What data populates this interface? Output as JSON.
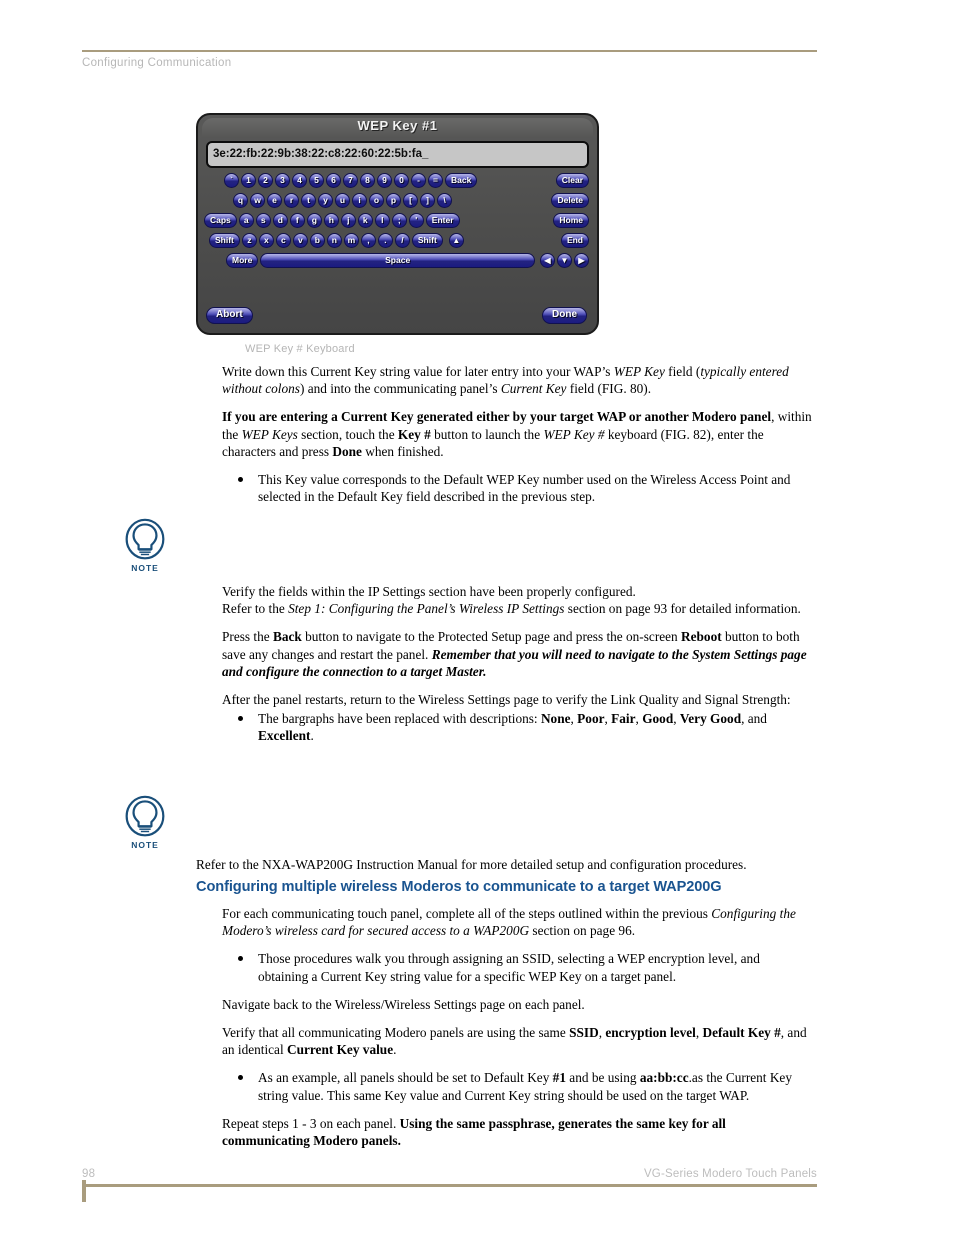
{
  "header": {
    "running_head": "Configuring Communication"
  },
  "figure": {
    "caption": "WEP Key # Keyboard",
    "keyboard": {
      "title": "WEP Key #1",
      "input_value": "3e:22:fb:22:9b:38:22:c8:22:60:22:5b:fa_",
      "row1": [
        "`",
        "1",
        "2",
        "3",
        "4",
        "5",
        "6",
        "7",
        "8",
        "9",
        "0",
        "-",
        "="
      ],
      "row1_actions": [
        "Back",
        "Clear"
      ],
      "row2": [
        "q",
        "w",
        "e",
        "r",
        "t",
        "y",
        "u",
        "i",
        "o",
        "p",
        "[",
        "]",
        "\\"
      ],
      "row2_actions": [
        "Delete"
      ],
      "row3_lead": "Caps",
      "row3": [
        "a",
        "s",
        "d",
        "f",
        "g",
        "h",
        "j",
        "k",
        "l",
        ";",
        "'"
      ],
      "row3_actions": [
        "Enter",
        "Home"
      ],
      "row4_lead": "Shift",
      "row4": [
        "z",
        "x",
        "c",
        "v",
        "b",
        "n",
        "m",
        ",",
        ".",
        "/"
      ],
      "row4_actions": [
        "Shift"
      ],
      "row4_arrows": [
        "▲"
      ],
      "row4_end": "End",
      "row5_lead": "More",
      "row5_space": "Space",
      "row5_arrows": [
        "◀",
        "▼",
        "▶"
      ],
      "abort": "Abort",
      "done": "Done"
    }
  },
  "body": {
    "p1_part1": "Write down this Current Key string value for later entry into your WAP’s ",
    "p1_italic1": "WEP Key",
    "p1_part2": " field (",
    "p1_italic2": "typically entered without colons",
    "p1_part3": ") and into the communicating panel’s ",
    "p1_italic3": "Current Key",
    "p1_part4": " field (FIG. 80).",
    "p2_bold1": "If you are entering a Current Key generated either by your target WAP or another Modero panel",
    "p2_part1": ", within the ",
    "p2_italic1": "WEP Keys",
    "p2_part2": " section, touch the ",
    "p2_bold2": "Key #",
    "p2_part3": " button to launch the ",
    "p2_italic2": "WEP Key #",
    "p2_part4": " keyboard (FIG. 82), enter the characters and press ",
    "p2_bold3": "Done",
    "p2_part5": " when finished.",
    "b1": "This Key value corresponds to the Default WEP Key number used on the Wireless Access Point and selected in the Default Key field described in the previous step.",
    "p3_line1": "Verify the fields within the IP Settings section have been properly configured.",
    "p3_part1": "Refer to the ",
    "p3_italic1": "Step 1: Configuring the Panel’s Wireless IP Settings",
    "p3_part2": " section on page 93 for detailed information.",
    "p4_part1": "Press the ",
    "p4_bold1": "Back",
    "p4_part2": " button to navigate to the Protected Setup page and press the on-screen ",
    "p4_bold2": "Reboot",
    "p4_part3": " button to both save any changes and restart the panel. ",
    "p4_bolditalic": "Remember that you will need to navigate to the System Settings page and configure the connection to a target Master.",
    "p5": "After the panel restarts, return to the Wireless Settings page to verify the Link Quality and Signal Strength:",
    "b2_part1": "The bargraphs have been replaced with descriptions: ",
    "b2_bold1": "None",
    "b2_sep1": ", ",
    "b2_bold2": "Poor",
    "b2_sep2": ", ",
    "b2_bold3": "Fair",
    "b2_sep3": ", ",
    "b2_bold4": "Good",
    "b2_sep4": ", ",
    "b2_bold5": "Very Good",
    "b2_sep5": ", and ",
    "b2_bold6": "Excellent",
    "b2_end": ".",
    "p6": "Refer to the NXA-WAP200G Instruction Manual for more detailed setup and configuration procedures.",
    "heading": "Configuring multiple wireless Moderos to communicate to a target WAP200G",
    "p7_part1": "For each communicating touch panel, complete all of the steps outlined within the previous ",
    "p7_italic1": "Configuring the Modero’s wireless card for secured access to a WAP200G",
    "p7_part2": " section on page 96.",
    "b3": "Those procedures walk you through assigning an SSID, selecting a WEP encryption level, and obtaining a Current Key string value for a specific WEP Key on a target panel.",
    "p8": "Navigate back to the Wireless/Wireless Settings page on each panel.",
    "p9_part1": "Verify that all communicating Modero panels are using the same ",
    "p9_bold1": "SSID",
    "p9_sep1": ", ",
    "p9_bold2": "encryption level",
    "p9_sep2": ", ",
    "p9_bold3": "Default Key #",
    "p9_part2": ", and an identical ",
    "p9_bold4": "Current Key value",
    "p9_end": ".",
    "b4_part1": "As an example, all panels should be set to Default Key ",
    "b4_bold1": "#1",
    "b4_part2": " and be using ",
    "b4_bold2": "aa:bb:cc",
    "b4_part3": ".as the Current Key string value. This same Key value and Current Key string should be used on the target WAP.",
    "p10_part1": "Repeat steps 1 - 3 on each panel. ",
    "p10_bold1": "Using the same passphrase, generates the same key for all communicating Modero panels."
  },
  "notes": {
    "label": "NOTE"
  },
  "footer": {
    "page_number": "98",
    "doc_title": "VG-Series Modero Touch Panels"
  },
  "colors": {
    "rule": "#a99c7e",
    "heading_blue": "#1a5490",
    "note_blue": "#1a4f7a",
    "key_blue": "#2e2ea8"
  }
}
